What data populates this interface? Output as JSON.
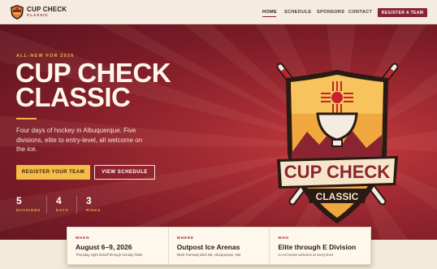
{
  "brand": {
    "name": "CUP CHECK",
    "sub": "CLASSIC"
  },
  "nav": {
    "items": [
      {
        "label": "HOME",
        "active": true
      },
      {
        "label": "SCHEDULE",
        "active": false
      },
      {
        "label": "SPONSORS",
        "active": false
      },
      {
        "label": "CONTACT",
        "active": false
      }
    ],
    "cta": "REGISTER A TEAM"
  },
  "hero": {
    "kicker": "ALL-NEW FOR 2026",
    "title_line1": "CUP CHECK",
    "title_line2": "CLASSIC",
    "description": "Four days of hockey in Albuquerque. Five divisions, elite to entry-level, all welcome on the ice.",
    "primary_button": "REGISTER YOUR TEAM",
    "secondary_button": "VIEW SCHEDULE",
    "stats": [
      {
        "number": "5",
        "label": "DIVISIONS"
      },
      {
        "number": "4",
        "label": "DAYS"
      },
      {
        "number": "3",
        "label": "RINKS"
      }
    ]
  },
  "crest": {
    "line1": "CUP CHECK",
    "line2": "CLASSIC"
  },
  "info": [
    {
      "key": "WHEN",
      "value": "August 6–9, 2026",
      "sub": "Thursday night kickoff through Sunday finals"
    },
    {
      "key": "WHERE",
      "value": "Outpost Ice Arenas",
      "sub": "9530 Tramway Blvd NE, Albuquerque, NM"
    },
    {
      "key": "WHO",
      "value": "Elite through E Division",
      "sub": "Co-ed teams welcome at every level"
    }
  ],
  "colors": {
    "maroon": "#8a2431",
    "gold": "#f3bd47",
    "cream": "#f4ece0"
  }
}
